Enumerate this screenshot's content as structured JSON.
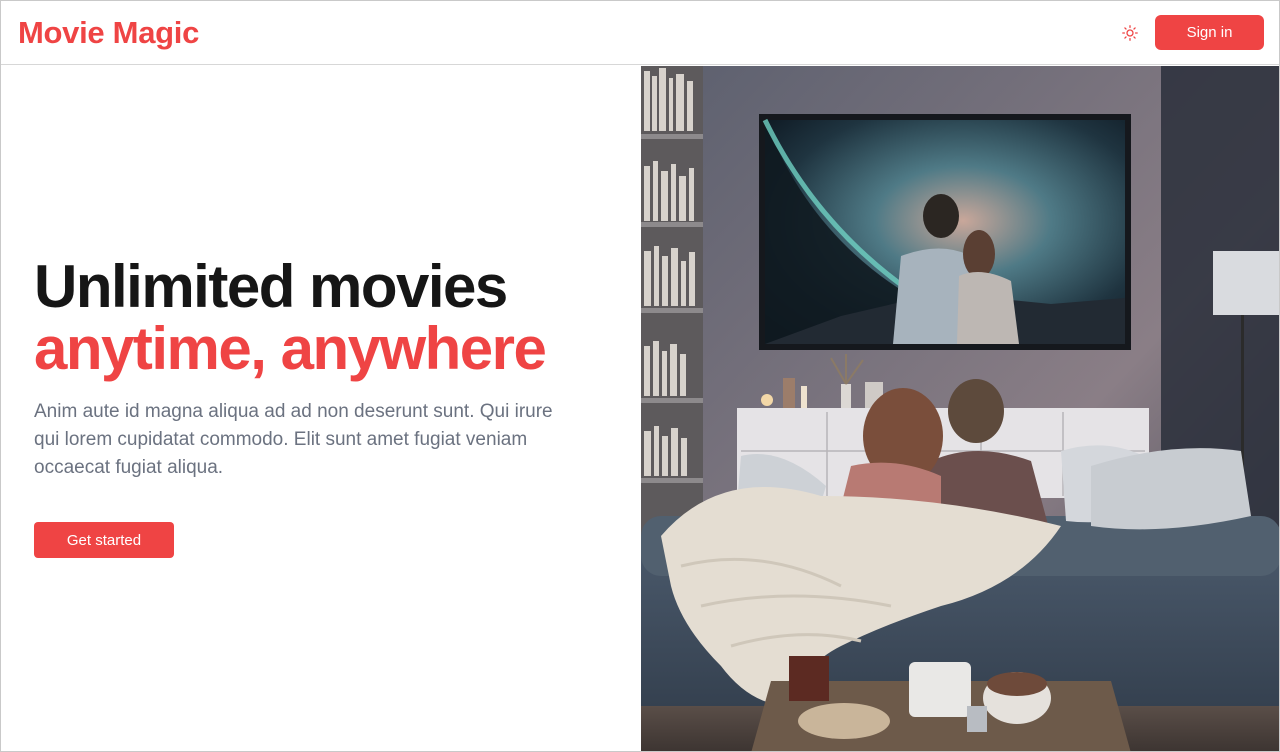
{
  "header": {
    "brand": "Movie Magic",
    "theme_icon": "sun-icon",
    "signin_label": "Sign in"
  },
  "hero": {
    "headline_line1": "Unlimited movies",
    "headline_line2": "anytime, anywhere",
    "description": "Anim aute id magna aliqua ad ad non deserunt sunt. Qui irure qui lorem cupidatat commodo. Elit sunt amet fugiat veniam occaecat fugiat aliqua.",
    "cta_label": "Get started"
  },
  "colors": {
    "accent": "#ef4444",
    "text_dark": "#161616",
    "text_muted": "#6b7280"
  }
}
